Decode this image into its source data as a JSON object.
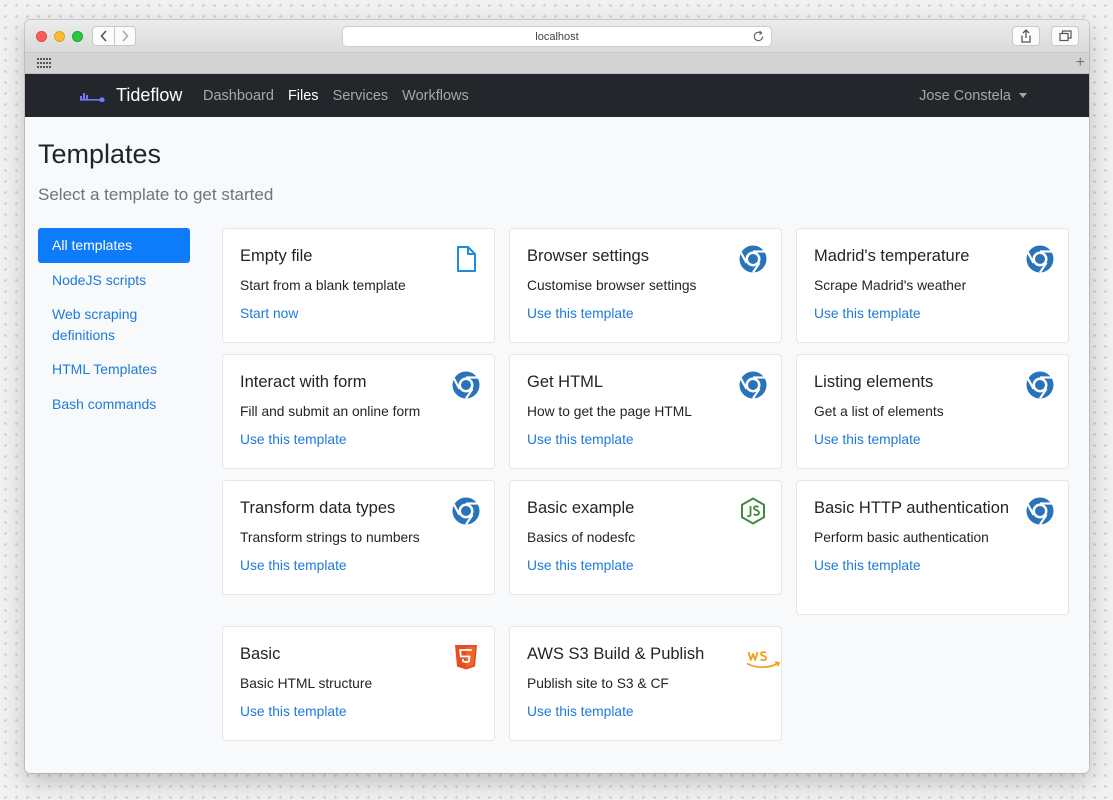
{
  "browser": {
    "url": "localhost"
  },
  "navbar": {
    "brand": "Tideflow",
    "links": [
      "Dashboard",
      "Files",
      "Services",
      "Workflows"
    ],
    "active_link": "Files",
    "user": "Jose Constela"
  },
  "page": {
    "title": "Templates",
    "subtitle": "Select a template to get started"
  },
  "sidebar": {
    "items": [
      "All templates",
      "NodeJS scripts",
      "Web scraping definitions",
      "HTML Templates",
      "Bash commands"
    ],
    "active": "All templates"
  },
  "cards": [
    {
      "title": "Empty file",
      "description": "Start from a blank template",
      "link": "Start now",
      "icon": "file-icon"
    },
    {
      "title": "Browser settings",
      "description": "Customise browser settings",
      "link": "Use this template",
      "icon": "chrome-icon"
    },
    {
      "title": "Madrid's temperature",
      "description": "Scrape Madrid's weather",
      "link": "Use this template",
      "icon": "chrome-icon"
    },
    {
      "title": "Interact with form",
      "description": "Fill and submit an online form",
      "link": "Use this template",
      "icon": "chrome-icon"
    },
    {
      "title": "Get HTML",
      "description": "How to get the page HTML",
      "link": "Use this template",
      "icon": "chrome-icon"
    },
    {
      "title": "Listing elements",
      "description": "Get a list of elements",
      "link": "Use this template",
      "icon": "chrome-icon"
    },
    {
      "title": "Transform data types",
      "description": "Transform strings to numbers",
      "link": "Use this template",
      "icon": "chrome-icon"
    },
    {
      "title": "Basic example",
      "description": "Basics of nodesfc",
      "link": "Use this template",
      "icon": "nodejs-icon"
    },
    {
      "title": "Basic HTTP authentication",
      "description": "Perform basic authentication",
      "link": "Use this template",
      "icon": "chrome-icon"
    },
    {
      "title": "Basic",
      "description": "Basic HTML structure",
      "link": "Use this template",
      "icon": "html5-icon"
    },
    {
      "title": "AWS S3 Build & Publish",
      "description": "Publish site to S3 & CF",
      "link": "Use this template",
      "icon": "aws-icon"
    }
  ],
  "colors": {
    "navbar": "#23272b",
    "link": "#1d7bd8",
    "active": "#0d7bfa",
    "chrome": "#2a73b8",
    "nodejs": "#3f8a3a",
    "html5": "#e44d26",
    "aws": "#f59c1a"
  }
}
